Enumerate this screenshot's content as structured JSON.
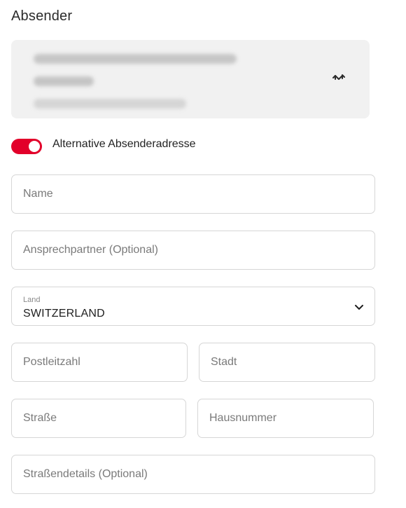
{
  "sender": {
    "heading": "Absender"
  },
  "alternative_toggle": {
    "label": "Alternative Absenderadresse",
    "enabled": true,
    "accent_color": "#e2002a"
  },
  "form": {
    "name": {
      "placeholder": "Name",
      "value": ""
    },
    "contact": {
      "placeholder": "Ansprechpartner (Optional)",
      "value": ""
    },
    "country": {
      "label": "Land",
      "value": "SWITZERLAND"
    },
    "postal_code": {
      "placeholder": "Postleitzahl",
      "value": ""
    },
    "city": {
      "placeholder": "Stadt",
      "value": ""
    },
    "street": {
      "placeholder": "Straße",
      "value": ""
    },
    "house_number": {
      "placeholder": "Hausnummer",
      "value": ""
    },
    "street_details": {
      "placeholder": "Straßendetails (Optional)",
      "value": ""
    }
  },
  "icons": {
    "swap": "swap-arrows-icon",
    "dropdown": "chevron-down-icon"
  }
}
